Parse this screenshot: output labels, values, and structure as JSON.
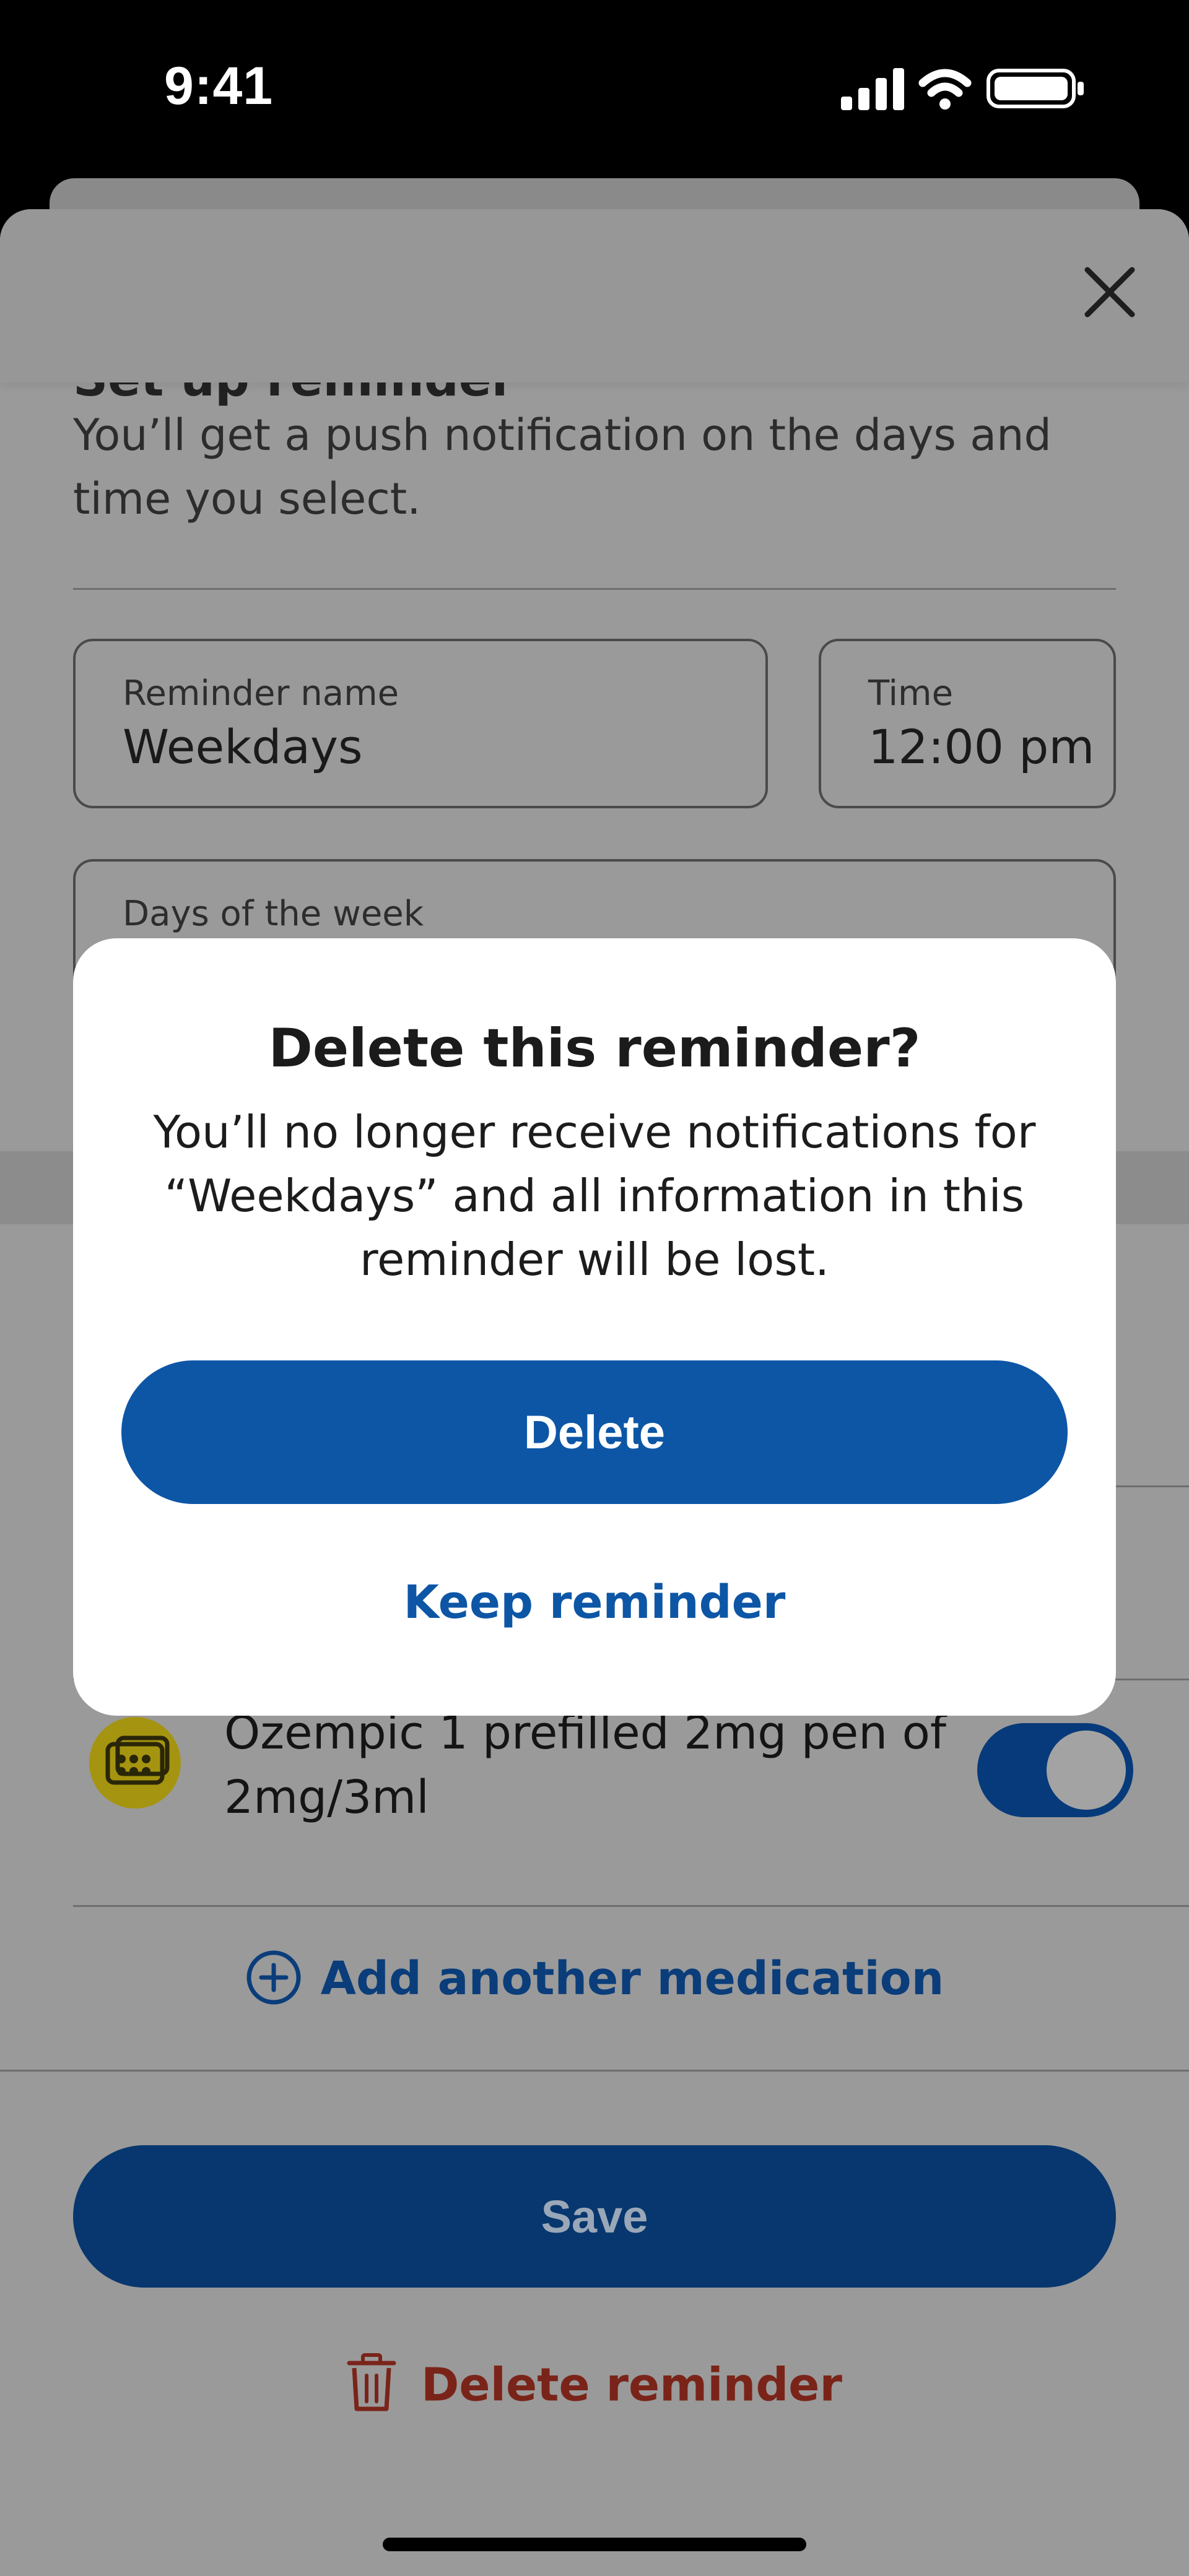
{
  "status_bar": {
    "time": "9:41"
  },
  "sheet": {
    "title": "Set up reminder",
    "description": "You’ll get a push notification on the days and time you select.",
    "reminder_name": {
      "label": "Reminder name",
      "value": "Weekdays"
    },
    "time": {
      "label": "Time",
      "value": "12:00 pm"
    },
    "days": {
      "label": "Days of the week"
    },
    "medication": {
      "name": "Ozempic 1 prefilled 2mg pen of 2mg/3ml",
      "enabled": true
    },
    "add_medication_label": "Add another medication",
    "save_label": "Save",
    "delete_reminder_label": "Delete reminder"
  },
  "modal": {
    "title": "Delete this reminder?",
    "body": "You’ll no longer receive notifications for “Weekdays” and all information in this reminder will be lost.",
    "delete_label": "Delete",
    "keep_label": "Keep reminder"
  },
  "colors": {
    "primary": "#0d56a6",
    "destructive": "#c0392b",
    "overlay": "#9a9a9a"
  },
  "icons": {
    "close": "close-icon",
    "add": "plus-circle-icon",
    "trash": "trash-icon",
    "pill": "pill-pack-icon"
  }
}
